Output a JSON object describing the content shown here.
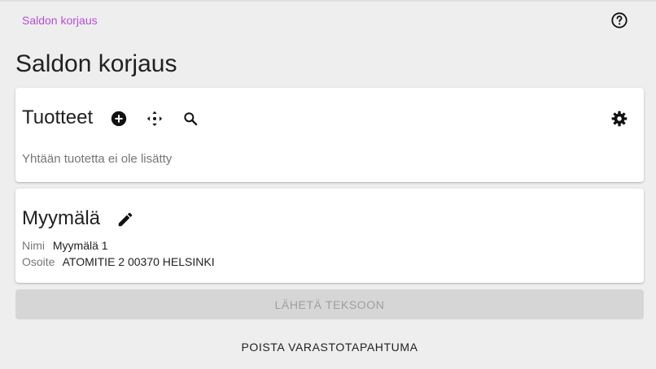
{
  "breadcrumb": {
    "label": "Saldon korjaus"
  },
  "help": {
    "icon": "help-circle-icon"
  },
  "page": {
    "title": "Saldon korjaus"
  },
  "products": {
    "title": "Tuotteet",
    "icons": [
      "add-circle-icon",
      "move-arrows-icon",
      "search-icon",
      "settings-gear-icon"
    ],
    "empty_text": "Yhtään tuotetta ei ole lisätty"
  },
  "store": {
    "title": "Myymälä",
    "edit_icon": "pencil-icon",
    "name_label": "Nimi",
    "name_value": "Myymälä 1",
    "address_label": "Osoite",
    "address_value": "ATOMITIE 2 00370 HELSINKI"
  },
  "actions": {
    "send_label": "LÄHETÄ TEKSOON",
    "delete_label": "POISTA VARASTOTAPAHTUMA"
  },
  "colors": {
    "background": "#eeeeee",
    "breadcrumb": "#b44fd6",
    "disabled_button": "#d6d6d6"
  }
}
